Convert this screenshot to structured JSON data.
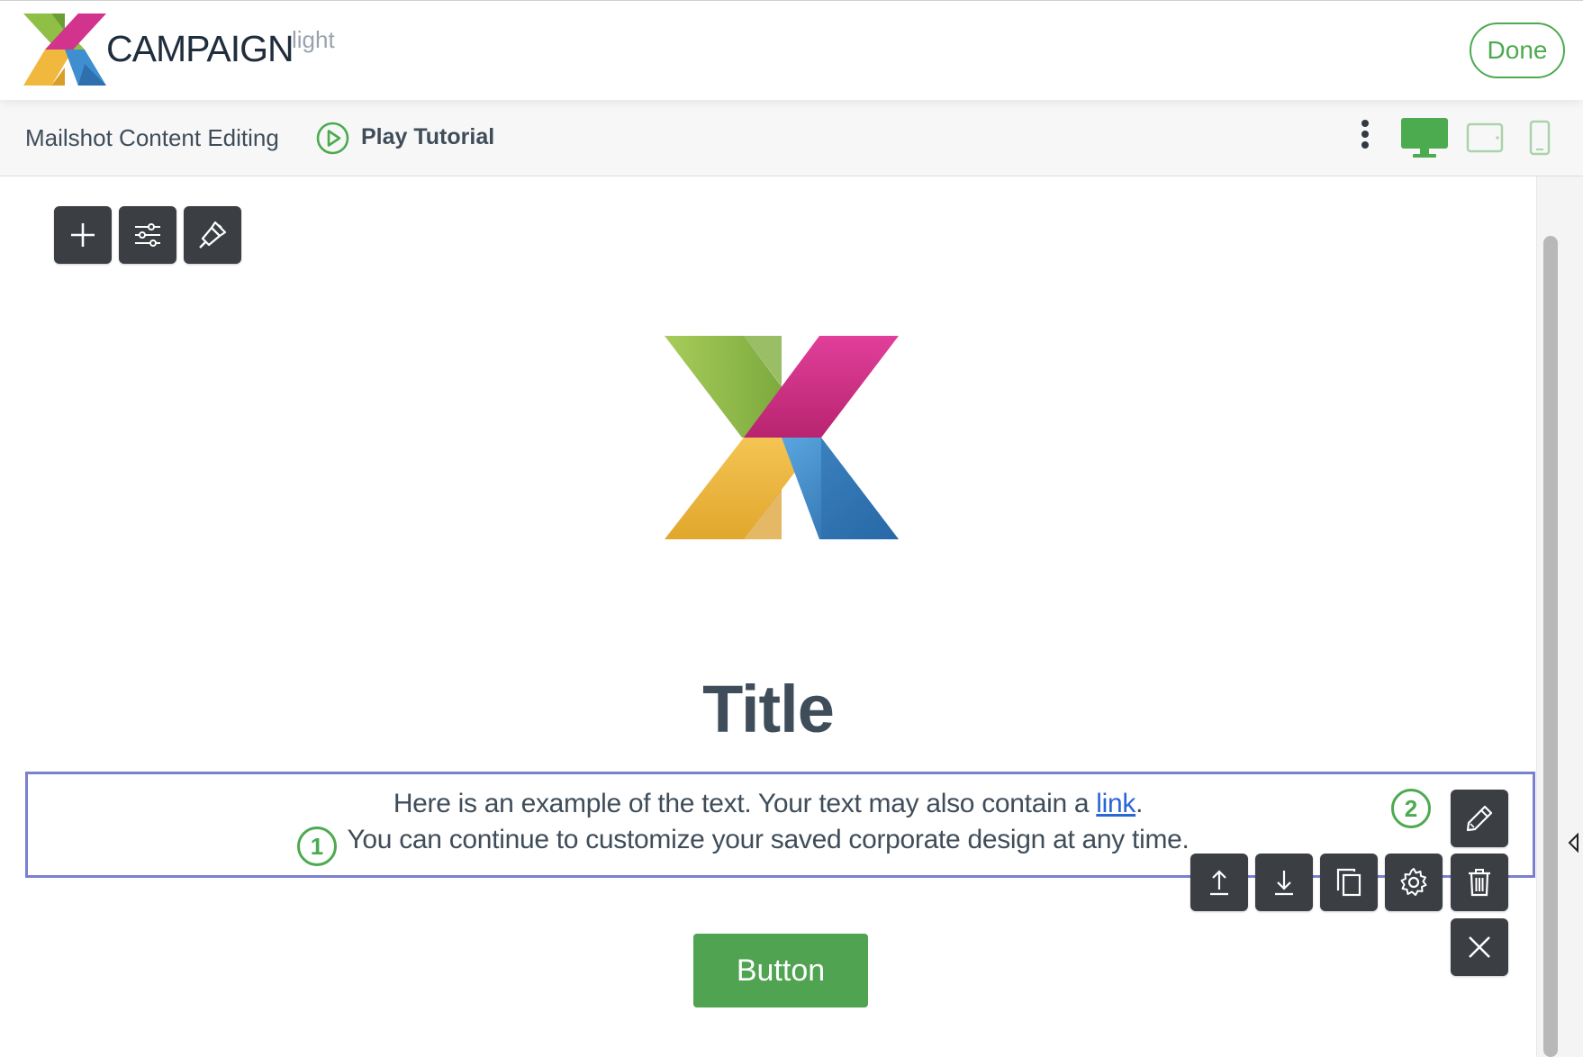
{
  "header": {
    "brand_name": "CAMPAIGN",
    "brand_sub": "light",
    "done_label": "Done"
  },
  "subbar": {
    "title": "Mailshot Content Editing",
    "tutorial_label": "Play Tutorial"
  },
  "editor": {
    "title": "Title",
    "text_line1_before": "Here is an example of the text. Your text may also contain a ",
    "text_link": "link",
    "text_line1_after": ".",
    "text_line2": "You can continue to customize your saved corporate design at any time.",
    "button_label": "Button",
    "marker1": "1",
    "marker2": "2"
  },
  "icons": {
    "top_toolbar": [
      "plus-icon",
      "sliders-icon",
      "paint-brush-icon"
    ],
    "block_toolbar": [
      "pencil-icon",
      "move-up-icon",
      "move-down-icon",
      "duplicate-icon",
      "gear-icon",
      "trash-icon",
      "close-icon"
    ],
    "devices": [
      "desktop-icon",
      "tablet-icon",
      "mobile-icon"
    ]
  },
  "colors": {
    "accent_green": "#4caa4f",
    "selection_border": "#7b7fcf",
    "toolbar_dark": "#3b3f44",
    "text": "#3f4d5a",
    "link": "#2a66d6",
    "logo_green": "#8fbf45",
    "logo_magenta": "#d2338d",
    "logo_yellow": "#f0b93e",
    "logo_blue": "#3f8fd0"
  }
}
